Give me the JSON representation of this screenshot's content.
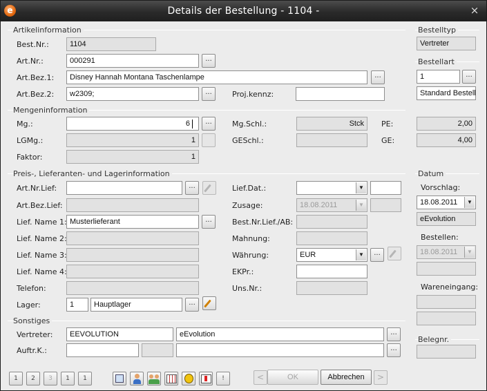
{
  "window": {
    "title": "Details der Bestellung - 1104 -",
    "app_icon": "e",
    "close_glyph": "×"
  },
  "sections": {
    "artikel": "Artikelinformation",
    "menge": "Mengeninformation",
    "preis": "Preis-, Lieferanten- und Lagerinformation",
    "sonstiges": "Sonstiges",
    "bestelltyp": "Bestelltyp",
    "bestellart": "Bestellart",
    "datum": "Datum",
    "belegnr": "Belegnr."
  },
  "labels": {
    "best_nr": "Best.Nr.:",
    "art_nr": "Art.Nr.:",
    "art_bez1": "Art.Bez.1:",
    "art_bez2": "Art.Bez.2:",
    "proj_kennz": "Proj.kennz:",
    "mg": "Mg.:",
    "lgmg": "LGMg.:",
    "faktor": "Faktor:",
    "mg_schl": "Mg.Schl.:",
    "geschl": "GESchl.:",
    "pe": "PE:",
    "ge": "GE:",
    "art_nr_lief": "Art.Nr.Lief:",
    "art_bez_lief": "Art.Bez.Lief:",
    "lief_name1": "Lief. Name 1:",
    "lief_name2": "Lief. Name 2:",
    "lief_name3": "Lief. Name 3:",
    "lief_name4": "Lief. Name 4:",
    "telefon": "Telefon:",
    "lager": "Lager:",
    "lief_dat": "Lief.Dat.:",
    "zusage": "Zusage:",
    "best_nr_lief_ab": "Best.Nr.Lief./AB:",
    "mahnung": "Mahnung:",
    "waehrung": "Währung:",
    "ekpr": "EKPr.:",
    "uns_nr": "Uns.Nr.:",
    "vertreter": "Vertreter:",
    "auftr_k": "Auftr.K.:",
    "vorschlag": "Vorschlag:",
    "bestellen": "Bestellen:",
    "wareneingang": "Wareneingang:"
  },
  "values": {
    "best_nr": "1104",
    "art_nr": "000291",
    "art_bez1": "Disney Hannah Montana Taschenlampe",
    "art_bez2": "w2309;",
    "proj_kennz": "",
    "mg": "6",
    "lgmg": "1",
    "faktor": "1",
    "mg_schl": "Stck",
    "geschl": "",
    "pe": "2,00",
    "ge": "4,00",
    "art_nr_lief": "",
    "art_bez_lief": "",
    "lief_name1": "Musterlieferant",
    "lief_name2": "",
    "lief_name3": "",
    "lief_name4": "",
    "telefon": "",
    "lager_nr": "1",
    "lager_name": "Hauptlager",
    "lief_dat": "",
    "lief_dat_extra": "",
    "zusage": "18.08.2011",
    "zusage_extra": "",
    "best_nr_lief_ab": "",
    "mahnung": "",
    "waehrung": "EUR",
    "ekpr": "",
    "uns_nr": "",
    "vertreter_code": "EEVOLUTION",
    "vertreter_name": "eEvolution",
    "auftr_k1": "",
    "auftr_k2": "",
    "auftr_k3": "",
    "bestelltyp": "Vertreter",
    "bestellart_nr": "1",
    "bestellart_name": "Standard Bestellu",
    "vorschlag_date": "18.08.2011",
    "vorschlag_user": "eEvolution",
    "bestellen_date": "18.08.2011",
    "bestellen_user": "",
    "wareneingang1": "",
    "wareneingang2": "",
    "belegnr": ""
  },
  "buttons": {
    "lookup": "...",
    "ok": "OK",
    "abbrechen": "Abbrechen",
    "prev": "<",
    "next": ">"
  },
  "toolbar_left": [
    "1",
    "2",
    "3",
    "1",
    "1"
  ],
  "toolbar_extra": "!"
}
